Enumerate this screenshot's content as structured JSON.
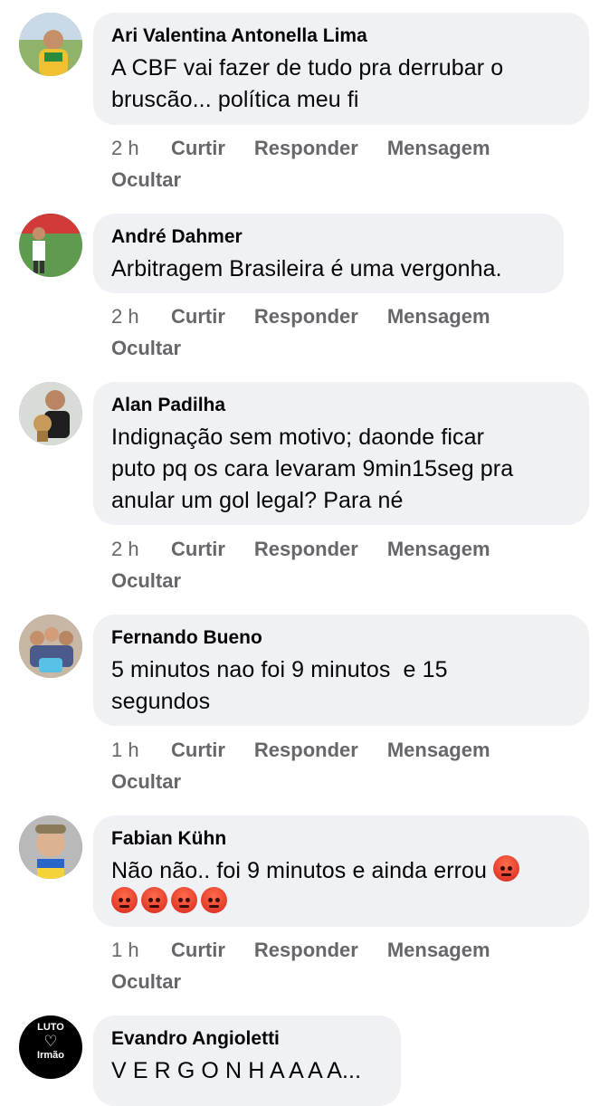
{
  "actions": {
    "like": "Curtir",
    "reply": "Responder",
    "message": "Mensagem",
    "hide": "Ocultar"
  },
  "comments": [
    {
      "name": "Ari Valentina Antonella Lima",
      "text": "A CBF vai fazer de tudo pra derrubar o\nbruscão... política meu fi",
      "time": "2 h"
    },
    {
      "name": "André Dahmer",
      "text": "Arbitragem Brasileira é uma vergonha.",
      "time": "2 h"
    },
    {
      "name": "Alan Padilha",
      "text": "Indignação sem motivo; daonde ficar\nputo pq os cara levaram 9min15seg pra\nanular um gol legal? Para né",
      "time": "2 h"
    },
    {
      "name": "Fernando Bueno",
      "text": "5 minutos nao foi 9 minutos  e 15\nsegundos",
      "time": "1 h"
    },
    {
      "name": "Fabian Kühn",
      "text": "Não não.. foi 9 minutos e ainda errou",
      "emojis": [
        "angry-emoji",
        "angry-emoji",
        "angry-emoji",
        "angry-emoji",
        "angry-emoji"
      ],
      "time": "1 h"
    },
    {
      "name": "Evandro Angioletti",
      "text": "V E R G O N H A A A A..."
    }
  ],
  "avatars": {
    "luto_top": "LUTO",
    "luto_bottom": "Irmão",
    "luto_icon": "heart-icon"
  }
}
